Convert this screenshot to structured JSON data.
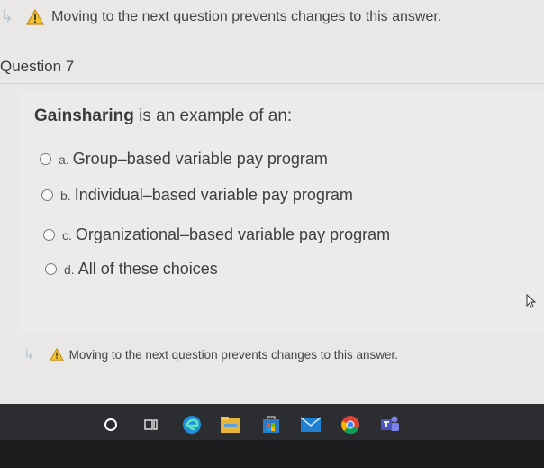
{
  "warning": {
    "text": "Moving to the next question prevents changes to this answer.",
    "icon": "warning-triangle-icon"
  },
  "question": {
    "heading": "Question 7",
    "prompt_bold": "Gainsharing",
    "prompt_rest": " is an example of an:",
    "choices": [
      {
        "letter": "a.",
        "text": "Group–based variable pay program"
      },
      {
        "letter": "b.",
        "text": "Individual–based variable pay program"
      },
      {
        "letter": "c.",
        "text": "Organizational–based variable pay program"
      },
      {
        "letter": "d.",
        "text": "All of these choices"
      }
    ]
  },
  "taskbar": {
    "icons": [
      "cortana-icon",
      "task-view-icon",
      "edge-icon",
      "file-explorer-icon",
      "store-icon",
      "mail-icon",
      "chrome-icon",
      "teams-icon"
    ]
  },
  "colors": {
    "warning": "#f2c230",
    "taskbar": "#2b2d31"
  }
}
